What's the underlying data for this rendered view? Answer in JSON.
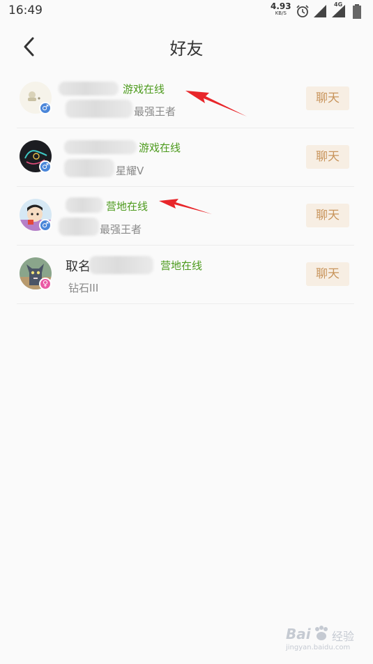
{
  "status_bar": {
    "time": "16:49",
    "net_speed_value": "4.93",
    "net_speed_unit": "KB/S",
    "network_type": "4G"
  },
  "header": {
    "title": "好友"
  },
  "friends": [
    {
      "name": "",
      "status": "游戏在线",
      "rank": "最强王者",
      "gender": "male",
      "chat_label": "聊天"
    },
    {
      "name": "",
      "status": "游戏在线",
      "rank": "星耀V",
      "gender": "male",
      "chat_label": "聊天"
    },
    {
      "name": "",
      "status": "营地在线",
      "rank": "最强王者",
      "gender": "male",
      "chat_label": "聊天"
    },
    {
      "name": "取名",
      "status": "营地在线",
      "rank": "钻石III",
      "gender": "female",
      "chat_label": "聊天"
    }
  ],
  "colors": {
    "online_status": "#4c9a1c",
    "chat_button_bg": "#f7eee3",
    "chat_button_text": "#c8945b",
    "annotation_arrow": "#e8262a"
  },
  "watermark": {
    "brand": "Bai",
    "suffix": "经验",
    "url": "jingyan.baidu.com"
  }
}
